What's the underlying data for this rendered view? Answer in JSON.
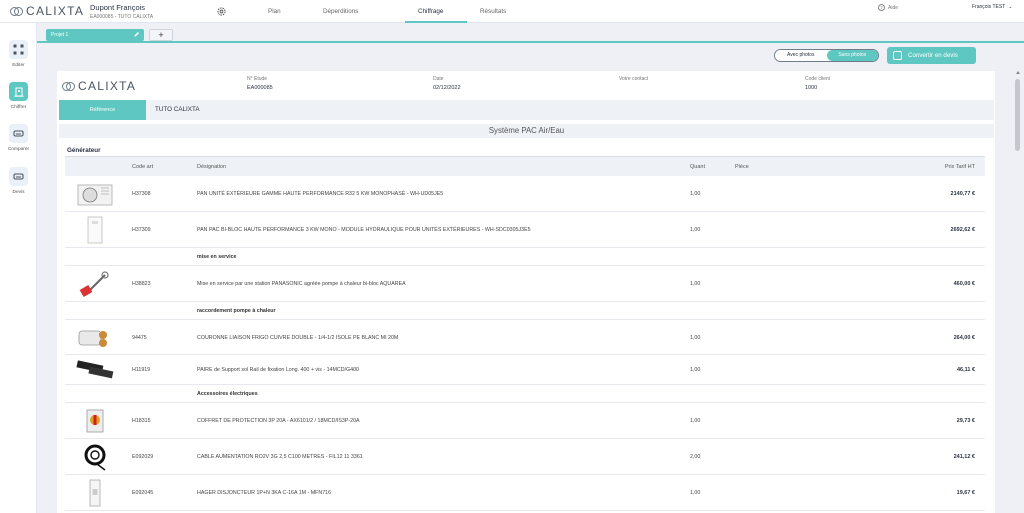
{
  "header": {
    "logo": "CALIXTA",
    "client_name": "Dupont François",
    "client_ref": "EA000085 - TUTO CALIXTA",
    "tabs": [
      "Plan",
      "Déperditions",
      "Chiffrage",
      "Résultats"
    ],
    "active_tab": "Chiffrage",
    "help_label": "Aide",
    "user_name": "François TEST"
  },
  "sidebar": {
    "items": [
      {
        "label": "Editer",
        "icon": "grid-icon"
      },
      {
        "label": "Chiffrer",
        "icon": "building-icon"
      },
      {
        "label": "Comparer",
        "icon": "sofa-icon"
      },
      {
        "label": "Devis",
        "icon": "sofa-icon"
      }
    ],
    "active": "Chiffrer"
  },
  "project": {
    "tab_label": "Projet 1",
    "add_label": "+"
  },
  "toolbar": {
    "toggle_with": "Avec photos",
    "toggle_without": "Sans photos",
    "convert_label": "Convertir en devis"
  },
  "document": {
    "logo": "CALIXTA",
    "meta": [
      {
        "label": "N° Etude",
        "value": "EA000085"
      },
      {
        "label": "Date",
        "value": "02/12/2022"
      },
      {
        "label": "Votre contact",
        "value": ""
      },
      {
        "label": "Code client",
        "value": "1000"
      }
    ],
    "reference_label": "Référence",
    "reference_value": "TUTO CALIXTA",
    "system_title": "Système PAC Air/Eau",
    "group_label": "Générateur",
    "columns": {
      "code": "Code art",
      "designation": "Désignation",
      "qty": "Quant",
      "piece": "Pièce",
      "price": "Prix Tarif HT"
    },
    "rows": [
      {
        "type": "item",
        "thumb": "outdoor-unit",
        "code": "H37308",
        "designation": "PAN UNITÉ EXTÉRIEURE GAMME HAUTE PERFORMANCE R32 5 KW MONOPHASÉ - WH-UD05JE5",
        "qty": "1,00",
        "price": "2140,77 €"
      },
      {
        "type": "item",
        "thumb": "hydro-module",
        "code": "H37309",
        "designation": "PAN PAC BI-BLOC HAUTE PERFORMANCE 3 KW MONO - MODULE HYDRAULIQUE POUR UNITÉS EXTÉRIEURES - WH-SDC0305J3E5",
        "qty": "1,00",
        "price": "2692,62 €"
      },
      {
        "type": "section",
        "label": "mise en service"
      },
      {
        "type": "item",
        "thumb": "tools",
        "code": "H38823",
        "designation": "Mise en service par une station PANASONIC agréée pompe à chaleur bi-bloc AQUAREA",
        "qty": "1,00",
        "price": "460,00 €"
      },
      {
        "type": "section",
        "label": "raccordement pompe à chaleur"
      },
      {
        "type": "item",
        "thumb": "copper-coil",
        "code": "94475",
        "designation": "COURONNE LIAISON FRIGO CUIVRE DOUBLE - 1/4-1/2 ISOLE PE BLANC MI 20M",
        "qty": "1,00",
        "price": "264,00 €"
      },
      {
        "type": "item",
        "thumb": "rail-support",
        "code": "H11919",
        "designation": "PAIRE de Support sol Rail de fixation Long. 400 + vis - 14MCD/G400",
        "qty": "1,00",
        "price": "46,11 €"
      },
      {
        "type": "section",
        "label": "Accessoires électriques"
      },
      {
        "type": "item",
        "thumb": "switch-box",
        "code": "H18315",
        "designation": "COFFRET DE PROTECTION 3P 20A - AX6101/2 / 18MCD/IS3P-20A",
        "qty": "1,00",
        "price": "29,73 €"
      },
      {
        "type": "item",
        "thumb": "cable-roll",
        "code": "E092029",
        "designation": "CABLE AUMENTATION RO2V 3G 2,5 C100 METRES - FIL12 11 3361",
        "qty": "2,00",
        "price": "241,12 €"
      },
      {
        "type": "item",
        "thumb": "breaker",
        "code": "E092045",
        "designation": "HAGER DISJONCTEUR 1P+N 3KA C-16A 1M - MFN716",
        "qty": "1,00",
        "price": "19,67 €"
      }
    ]
  },
  "colors": {
    "accent": "#5fc7c1",
    "panel": "#eef1f6"
  }
}
